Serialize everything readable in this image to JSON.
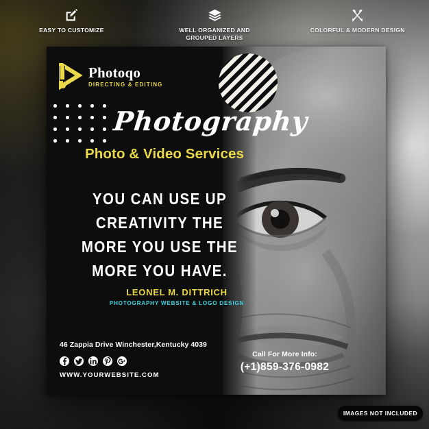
{
  "features": [
    {
      "icon": "pencil-square-icon",
      "label": "EASY TO CUSTOMIZE"
    },
    {
      "icon": "layers-icon",
      "label": "WELL ORGANIZED AND\nGROUPED LAYERS"
    },
    {
      "icon": "pencil-ruler-cross-icon",
      "label": "COLORFUL & MODERN DESIGN"
    }
  ],
  "poster": {
    "logo": {
      "icon": "play-triangle-icon",
      "name": "Photoqo",
      "tagline": "DIRECTING & EDITING"
    },
    "script_title": "Photography",
    "sub_title": "Photo & Video Services",
    "quote_lines": [
      "YOU CAN USE UP",
      "CREATIVITY THE",
      "MORE YOU USE THE",
      "MORE YOU HAVE."
    ],
    "author": {
      "name": "LEONEL M. DITTRICH",
      "role": "PHOTOGRAPHY WEBSITE & LOGO DESIGN"
    },
    "address": "46 Zappia Drive Winchester,Kentucky 4039",
    "website": "WWW.YOURWEBSITE.COM",
    "socials": [
      "facebook-icon",
      "twitter-icon",
      "linkedin-icon",
      "pinterest-icon",
      "googleplus-icon"
    ],
    "call_label": "Call For More Info:",
    "call_number": "(+1)859-376-0982"
  },
  "badge": {
    "label": "IMAGES NOT INCLUDED"
  },
  "colors": {
    "yellow": "#e8d84a",
    "cyan": "#3fd2e0",
    "poster_bg": "#0d0d0d",
    "white": "#ffffff"
  }
}
